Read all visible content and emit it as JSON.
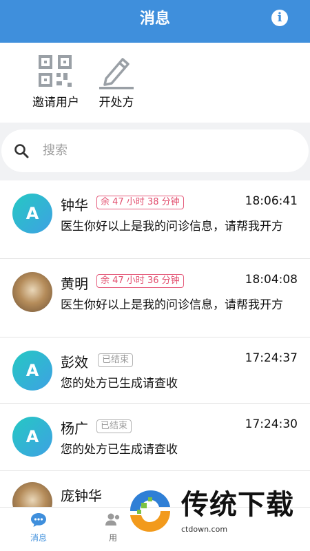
{
  "header": {
    "title": "消息",
    "info_icon": "info-icon"
  },
  "quick_actions": [
    {
      "label": "邀请用户",
      "icon": "qr-code-icon"
    },
    {
      "label": "开处方",
      "icon": "pencil-icon"
    }
  ],
  "search": {
    "placeholder": "搜索",
    "icon": "search-icon"
  },
  "conversations": [
    {
      "avatar_letter": "A",
      "name": "钟华",
      "tag": "余 47 小时 38 分钟",
      "time": "18:06:41",
      "message": "医生你好以上是我的问诊信息，请帮我开方"
    },
    {
      "avatar_letter": "",
      "name": "黄明",
      "tag": "余 47 小时 36 分钟",
      "time": "18:04:08",
      "message": "医生你好以上是我的问诊信息，请帮我开方"
    },
    {
      "avatar_letter": "A",
      "name": "彭效",
      "tag": "已结束",
      "time": "17:24:37",
      "message": "您的处方已生成请查收"
    },
    {
      "avatar_letter": "A",
      "name": "杨广",
      "tag": "已结束",
      "time": "17:24:30",
      "message": "您的处方已生成请查收"
    },
    {
      "avatar_letter": "",
      "name": "庞钟华",
      "tag": "",
      "time": "",
      "message": ""
    }
  ],
  "tabbar": [
    {
      "label": "消息",
      "icon": "chat-bubble-icon"
    },
    {
      "label": "用",
      "icon": "users-icon"
    }
  ],
  "watermark": {
    "text": "传统下载",
    "sub": "ctdown.com"
  },
  "colors": {
    "header_bg": "#3f8fdc",
    "tag_active": "#e24e6e",
    "tag_ended": "#999999",
    "avatar_gradient": [
      "#25c8c3",
      "#3ea1e3"
    ]
  }
}
